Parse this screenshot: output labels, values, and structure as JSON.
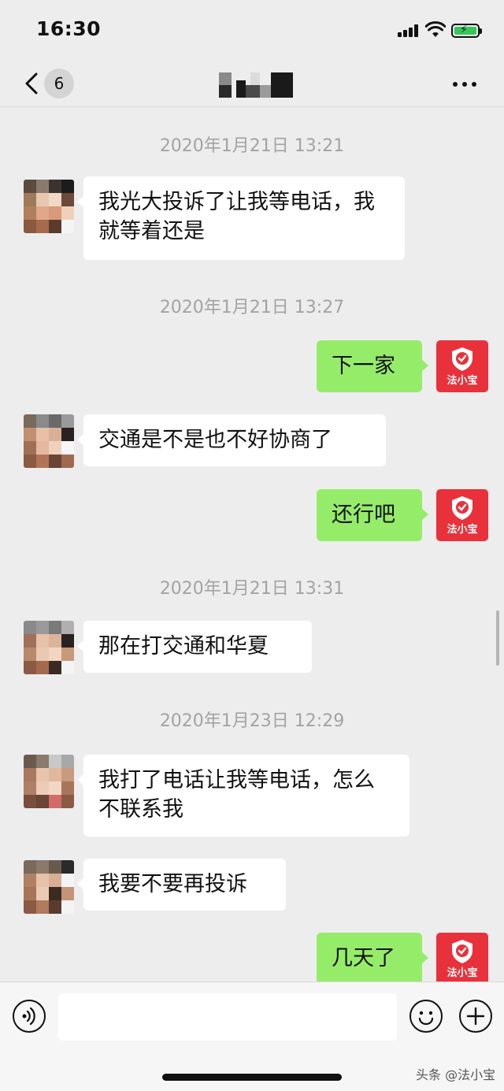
{
  "status_bar": {
    "time": "16:30"
  },
  "nav": {
    "back_badge": "6"
  },
  "messages": {
    "ts1": "2020年1月21日 13:21",
    "m1": "我光大投诉了让我等电话，我就等着还是",
    "ts2": "2020年1月21日 13:27",
    "m2": "下一家",
    "m3": "交通是不是也不好协商了",
    "m4": "还行吧",
    "ts3": "2020年1月21日 13:31",
    "m5": "那在打交通和华夏",
    "ts4": "2020年1月23日 12:29",
    "m6": "我打了电话让我等电话，怎么不联系我",
    "m7": "我要不要再投诉",
    "m8": "几天了"
  },
  "my_avatar": {
    "name": "法小宝"
  },
  "watermark": "头条 @法小宝",
  "colors": {
    "outgoing_bubble": "#95ec69",
    "incoming_bubble": "#ffffff",
    "avatar_red": "#e8313b",
    "background": "#ededed"
  }
}
